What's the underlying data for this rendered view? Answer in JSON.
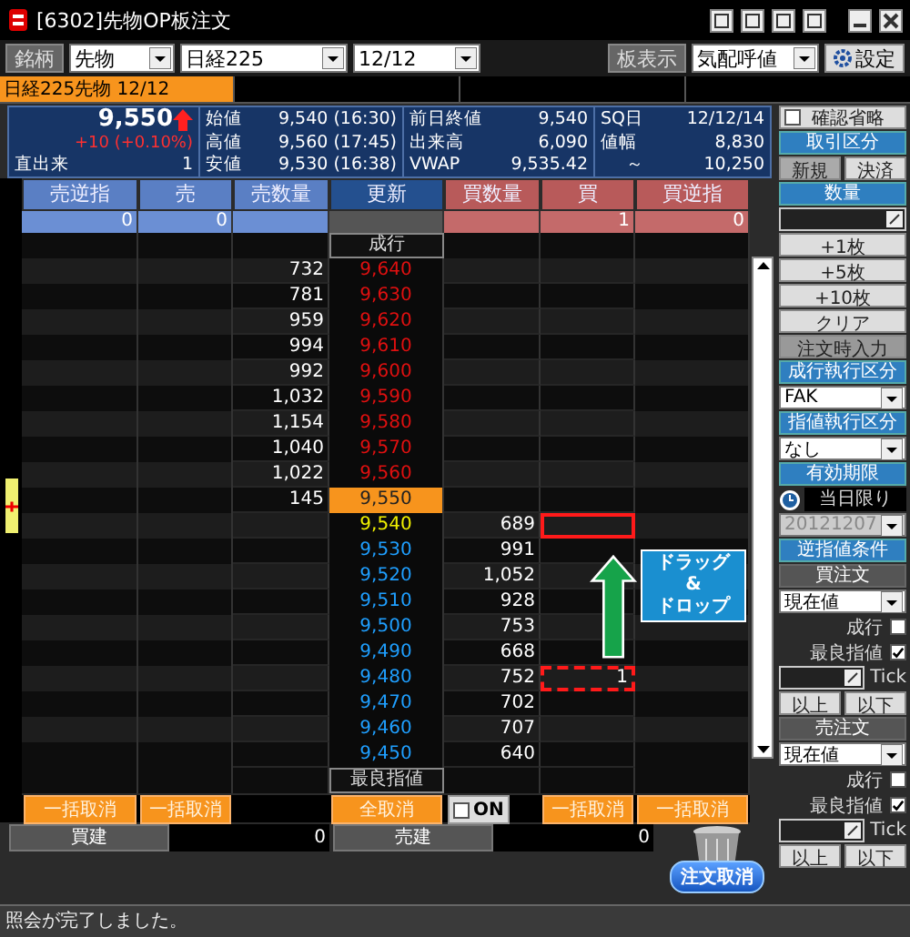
{
  "window": {
    "title": "[6302]先物OP板注文"
  },
  "toolbar": {
    "symbol_button": "銘柄",
    "selects": [
      "先物",
      "日経225",
      "12/12"
    ],
    "board_button": "板表示",
    "board_select": "気配呼値",
    "settings_button": "設定"
  },
  "tabs": [
    {
      "label": "日経225先物 12/12",
      "selected": true
    }
  ],
  "quote": {
    "price": "9,550",
    "rising": true,
    "change": "+10 (+0.10%)",
    "volume_label": "直出来",
    "volume": "1",
    "stats": [
      {
        "label": "始値",
        "value": "9,540 (16:30)"
      },
      {
        "label": "高値",
        "value": "9,560 (17:45)"
      },
      {
        "label": "安値",
        "value": "9,530 (16:38)"
      },
      {
        "label": "前日終値",
        "value": "9,540"
      },
      {
        "label": "出来高",
        "value": "6,090"
      },
      {
        "label": "VWAP",
        "value": "9,535.42"
      },
      {
        "label": "SQ日",
        "value": "12/12/14"
      },
      {
        "label": "値幅",
        "value": "8,830"
      }
    ],
    "range_to": {
      "mark": "～",
      "value": "10,250"
    }
  },
  "book": {
    "columns": [
      "売逆指",
      "売",
      "売数量",
      "更新",
      "買数量",
      "買",
      "買逆指"
    ],
    "totals": [
      "0",
      "0",
      "1",
      "0"
    ],
    "market_label": "成行",
    "rows": [
      {
        "price": "9,640",
        "sell_qty": "732",
        "buy_qty": "",
        "buy": "",
        "kind": "ask",
        "drop_target": false,
        "drag_source": false
      },
      {
        "price": "9,630",
        "sell_qty": "781",
        "buy_qty": "",
        "buy": "",
        "kind": "ask",
        "drop_target": false,
        "drag_source": false
      },
      {
        "price": "9,620",
        "sell_qty": "959",
        "buy_qty": "",
        "buy": "",
        "kind": "ask",
        "drop_target": false,
        "drag_source": false
      },
      {
        "price": "9,610",
        "sell_qty": "994",
        "buy_qty": "",
        "buy": "",
        "kind": "ask",
        "drop_target": false,
        "drag_source": false
      },
      {
        "price": "9,600",
        "sell_qty": "992",
        "buy_qty": "",
        "buy": "",
        "kind": "ask",
        "drop_target": false,
        "drag_source": false
      },
      {
        "price": "9,590",
        "sell_qty": "1,032",
        "buy_qty": "",
        "buy": "",
        "kind": "ask",
        "drop_target": false,
        "drag_source": false
      },
      {
        "price": "9,580",
        "sell_qty": "1,154",
        "buy_qty": "",
        "buy": "",
        "kind": "ask",
        "drop_target": false,
        "drag_source": false
      },
      {
        "price": "9,570",
        "sell_qty": "1,040",
        "buy_qty": "",
        "buy": "",
        "kind": "ask",
        "drop_target": false,
        "drag_source": false
      },
      {
        "price": "9,560",
        "sell_qty": "1,022",
        "buy_qty": "",
        "buy": "",
        "kind": "ask",
        "drop_target": false,
        "drag_source": false
      },
      {
        "price": "9,550",
        "sell_qty": "145",
        "buy_qty": "",
        "buy": "",
        "kind": "current",
        "drop_target": false,
        "drag_source": false
      },
      {
        "price": "9,540",
        "sell_qty": "",
        "buy_qty": "689",
        "buy": "",
        "kind": "best_bid",
        "drop_target": true,
        "drag_source": false
      },
      {
        "price": "9,530",
        "sell_qty": "",
        "buy_qty": "991",
        "buy": "",
        "kind": "bid",
        "drop_target": false,
        "drag_source": false
      },
      {
        "price": "9,520",
        "sell_qty": "",
        "buy_qty": "1,052",
        "buy": "",
        "kind": "bid",
        "drop_target": false,
        "drag_source": false
      },
      {
        "price": "9,510",
        "sell_qty": "",
        "buy_qty": "928",
        "buy": "",
        "kind": "bid",
        "drop_target": false,
        "drag_source": false
      },
      {
        "price": "9,500",
        "sell_qty": "",
        "buy_qty": "753",
        "buy": "",
        "kind": "bid",
        "drop_target": false,
        "drag_source": false
      },
      {
        "price": "9,490",
        "sell_qty": "",
        "buy_qty": "668",
        "buy": "",
        "kind": "bid",
        "drop_target": false,
        "drag_source": false
      },
      {
        "price": "9,480",
        "sell_qty": "",
        "buy_qty": "752",
        "buy": "1",
        "kind": "bid",
        "drop_target": false,
        "drag_source": true
      },
      {
        "price": "9,470",
        "sell_qty": "",
        "buy_qty": "702",
        "buy": "",
        "kind": "bid",
        "drop_target": false,
        "drag_source": false
      },
      {
        "price": "9,460",
        "sell_qty": "",
        "buy_qty": "707",
        "buy": "",
        "kind": "bid",
        "drop_target": false,
        "drag_source": false
      },
      {
        "price": "9,450",
        "sell_qty": "",
        "buy_qty": "640",
        "buy": "",
        "kind": "bid",
        "drop_target": false,
        "drag_source": false
      }
    ],
    "best_label": "最良指値",
    "drag_hint": [
      "ドラッグ",
      "&",
      "ドロップ"
    ],
    "cancel_buttons": [
      "一括取消",
      "一括取消",
      "全取消",
      "一括取消",
      "一括取消"
    ],
    "on_toggle": {
      "label": "ON",
      "checked": false
    }
  },
  "positions": [
    {
      "label": "買建",
      "value": "0"
    },
    {
      "label": "売建",
      "value": "0"
    }
  ],
  "cancel_order_button": "注文取消",
  "order_panel": [
    {
      "kind": "checkbox",
      "label": "確認省略",
      "checked": false
    },
    {
      "kind": "header",
      "label": "取引区分"
    },
    {
      "kind": "toggle_pair",
      "options": [
        {
          "label": "新規",
          "selected": true
        },
        {
          "label": "決済",
          "selected": false
        }
      ]
    },
    {
      "kind": "header",
      "label": "数量"
    },
    {
      "kind": "quantity_field"
    },
    {
      "kind": "button",
      "label": "+1枚"
    },
    {
      "kind": "button",
      "label": "+5枚"
    },
    {
      "kind": "button",
      "label": "+10枚"
    },
    {
      "kind": "button",
      "label": "クリア"
    },
    {
      "kind": "dark_button",
      "label": "注文時入力"
    },
    {
      "kind": "header",
      "label": "成行執行区分"
    },
    {
      "kind": "select",
      "value": "FAK"
    },
    {
      "kind": "header",
      "label": "指値執行区分"
    },
    {
      "kind": "select",
      "value": "なし"
    },
    {
      "kind": "header",
      "label": "有効期限"
    },
    {
      "kind": "expiry",
      "value": "当日限り"
    },
    {
      "kind": "date",
      "value": "20121207",
      "disabled": true
    },
    {
      "kind": "header",
      "label": "逆指値条件"
    },
    {
      "kind": "subheader",
      "label": "買注文"
    },
    {
      "kind": "select",
      "value": "現在値"
    },
    {
      "kind": "check",
      "label": "成行",
      "checked": false
    },
    {
      "kind": "check",
      "label": "最良指値",
      "checked": true
    },
    {
      "kind": "tick_field",
      "unit": "Tick"
    },
    {
      "kind": "button_pair",
      "options": [
        "以上",
        "以下"
      ]
    },
    {
      "kind": "subheader",
      "label": "売注文"
    },
    {
      "kind": "select",
      "value": "現在値"
    },
    {
      "kind": "check",
      "label": "成行",
      "checked": false
    },
    {
      "kind": "check",
      "label": "最良指値",
      "checked": true
    },
    {
      "kind": "tick_field",
      "unit": "Tick"
    },
    {
      "kind": "button_pair",
      "options": [
        "以上",
        "以下"
      ]
    }
  ],
  "status_bar": "照会が完了しました。"
}
